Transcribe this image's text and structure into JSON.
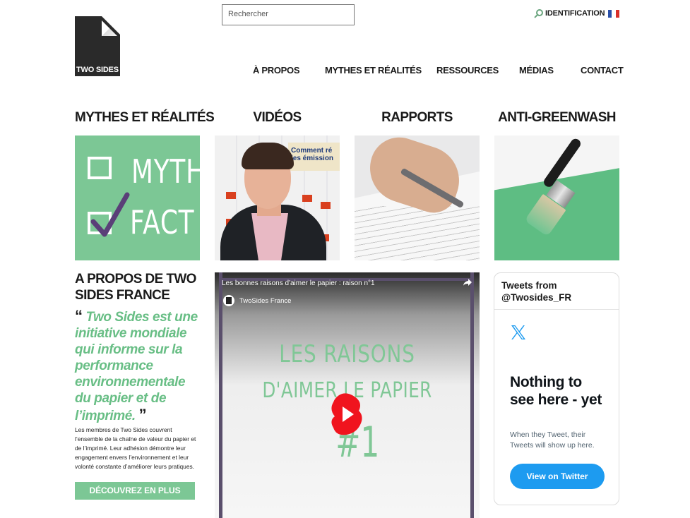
{
  "brand": {
    "logo_text": "TWO SIDES"
  },
  "search": {
    "placeholder": "Rechercher"
  },
  "topbar": {
    "identification": "IDENTIFICATION",
    "flag_icon": "france-flag-icon"
  },
  "nav": {
    "items": [
      "À PROPOS",
      "MYTHES ET RÉALITÉS",
      "RESSOURCES",
      "MÉDIAS",
      "CONTACT"
    ]
  },
  "sections": [
    {
      "heading": "MYTHES ET RÉALITÉS",
      "tile_words": [
        "MYTH",
        "FACT"
      ]
    },
    {
      "heading": "VIDÉOS",
      "poster_text": "Comment ré\nles émission"
    },
    {
      "heading": "RAPPORTS"
    },
    {
      "heading": "ANTI-GREENWASH"
    }
  ],
  "about": {
    "title": "A PROPOS DE TWO SIDES FRANCE",
    "quote_open": "“",
    "quote": "Two Sides est une initiative mondiale qui informe sur la performance environnementale du papier et de l’imprimé.",
    "quote_close": "”",
    "description": "Les membres de Two Sides couvrent l’ensemble de la chaîne de valeur du papier et de l’imprimé. Leur adhésion démontre leur engagement envers l’environnement et leur volonté constante d’améliorer leurs pratiques.",
    "button": "DÉCOUVREZ EN PLUS"
  },
  "video": {
    "title": "Les bonnes raisons d'aimer le papier : raison n°1",
    "channel": "TwoSides France",
    "overlay_line1": "LES RAISONS",
    "overlay_line2": "D'AIMER LE PAPIER",
    "overlay_line3": "#1"
  },
  "twitter": {
    "header": "Tweets from @Twosides_FR",
    "empty_title": "Nothing to see here - yet",
    "empty_text": "When they Tweet, their Tweets will show up here.",
    "button": "View on Twitter"
  },
  "colors": {
    "brand_green": "#7cc795",
    "twitter_blue": "#1d9bf0",
    "dark": "#2a2a2a"
  }
}
